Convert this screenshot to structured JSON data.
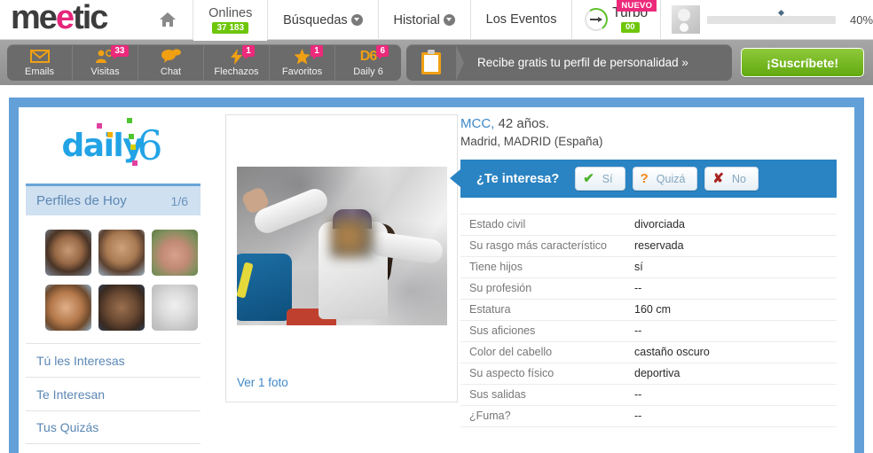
{
  "brand": {
    "name_part1": "me",
    "name_part2": "e",
    "name_part3": "tic"
  },
  "topnav": {
    "home_icon": "home-icon",
    "items": [
      {
        "label": "Onlines",
        "badge": "37 183",
        "has_caret": false,
        "active": true
      },
      {
        "label": "Búsquedas",
        "badge": "",
        "has_caret": true,
        "active": false
      },
      {
        "label": "Historial",
        "badge": "",
        "has_caret": true,
        "active": false
      },
      {
        "label": "Los Eventos",
        "badge": "",
        "has_caret": false,
        "active": false
      }
    ],
    "turbo": {
      "label": "Turbo",
      "count": "00",
      "flag": "NUEVO"
    },
    "profile": {
      "progress_pct": "40%",
      "progress_value": 40
    }
  },
  "actionbar": {
    "items": [
      {
        "label": "Emails",
        "badge": "",
        "icon": "envelope-icon"
      },
      {
        "label": "Visitas",
        "badge": "33",
        "icon": "visitors-icon"
      },
      {
        "label": "Chat",
        "badge": "",
        "icon": "chat-bubble-icon"
      },
      {
        "label": "Flechazos",
        "badge": "1",
        "icon": "lightning-bolt-icon"
      },
      {
        "label": "Favoritos",
        "badge": "1",
        "icon": "star-icon"
      },
      {
        "label": "Daily 6",
        "badge": "6",
        "icon": "d6-icon"
      }
    ],
    "promo_text": "Recibe gratis tu perfil de personalidad »",
    "promo_icon": "clipboard-icon",
    "subscribe_label": "¡Suscríbete!"
  },
  "sidebar": {
    "logo_word": "daily",
    "logo_six": "6",
    "section_title": "Perfiles de Hoy",
    "section_count": "1/6",
    "thumbnails": [
      "thumb-1",
      "thumb-2",
      "thumb-3",
      "thumb-4",
      "thumb-5",
      "thumb-6"
    ],
    "links": [
      {
        "label": "Tú les Interesas"
      },
      {
        "label": "Te Interesan"
      },
      {
        "label": "Tus Quizás"
      }
    ]
  },
  "photo": {
    "view_photos_label": "Ver 1 foto",
    "alt": "profile-photo"
  },
  "profile": {
    "name": "MCC,",
    "age": " 42 años.",
    "location": "Madrid, MADRID (España)",
    "interest_question": "¿Te interesa?",
    "buttons": [
      {
        "glyph": "✔",
        "label": "Sí",
        "name": "yes-button"
      },
      {
        "glyph": "?",
        "label": "Quizá",
        "name": "maybe-button"
      },
      {
        "glyph": "✘",
        "label": "No",
        "name": "no-button"
      }
    ],
    "specs": [
      {
        "key": "Estado civil",
        "value": "divorciada"
      },
      {
        "key": "Su rasgo más característico",
        "value": "reservada"
      },
      {
        "key": "Tiene hijos",
        "value": "sí"
      },
      {
        "key": "Su profesión",
        "value": "--"
      },
      {
        "key": "Estatura",
        "value": "160 cm"
      },
      {
        "key": "Sus aficiones",
        "value": "--"
      },
      {
        "key": "Color del cabello",
        "value": "castaño oscuro"
      },
      {
        "key": "Su aspecto físico",
        "value": "deportiva"
      },
      {
        "key": "Sus salidas",
        "value": "--"
      },
      {
        "key": "¿Fuma?",
        "value": "--"
      }
    ]
  },
  "colors": {
    "brand_pink": "#e6267a",
    "frame_blue": "#63a0d8",
    "accent_blue": "#2a83c2",
    "badge_green": "#6ec60a",
    "badge_pink": "#ec297b",
    "subscribe_green": "#8ec93a"
  }
}
